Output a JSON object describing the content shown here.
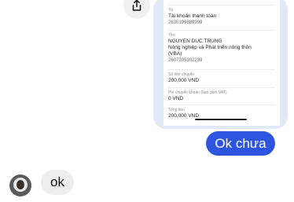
{
  "receipt": {
    "account_type_label": "Từ",
    "account_type": "Tài khoản thanh toán",
    "account_number": "2630199889999",
    "recipient_label": "Tên",
    "recipient_name": "NGUYEN DUC TRUNG",
    "recipient_bank_line1": "Nông nghiệp và Phát triển nông thôn",
    "recipient_bank_line2": "(VBA)",
    "recipient_account": "2607205302239",
    "amount_label": "Số tiền chuyển",
    "amount": "200,000 VND",
    "fee_label": "Phí chuyển khoản (bao gồm VAT)",
    "fee": "0 VND",
    "total_label": "Tổng tiền",
    "total": "200,000 VND"
  },
  "messages": {
    "outgoing_text": "Ok chưa",
    "incoming_text": "ok"
  },
  "colors": {
    "outgoing_bubble": "#2e55e0",
    "incoming_bubble": "#eeeeee",
    "image_frame": "#dfe9f7"
  }
}
